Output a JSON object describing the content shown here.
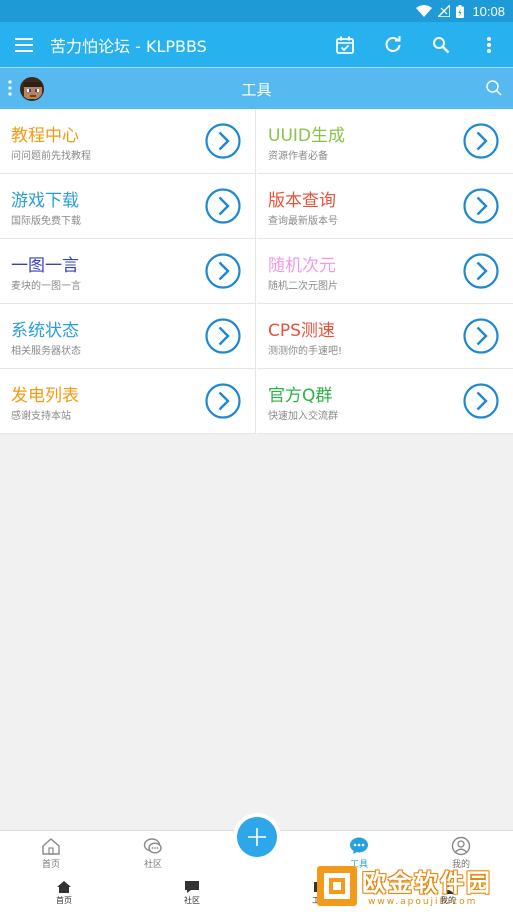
{
  "status_bar": {
    "time": "10:08"
  },
  "toolbar": {
    "title": "苦力怕论坛 - KLPBBS"
  },
  "subbar": {
    "title": "工具"
  },
  "tools": [
    {
      "title": "教程中心",
      "subtitle": "问问题前先找教程",
      "color": "#f39b12"
    },
    {
      "title": "UUID生成",
      "subtitle": "资源作者必备",
      "color": "#8bc34a"
    },
    {
      "title": "游戏下载",
      "subtitle": "国际版免费下载",
      "color": "#2b9fd8"
    },
    {
      "title": "版本查询",
      "subtitle": "查询最新版本号",
      "color": "#e5533d"
    },
    {
      "title": "一图一言",
      "subtitle": "麦块的一图一言",
      "color": "#3a3fbf"
    },
    {
      "title": "随机次元",
      "subtitle": "随机二次元图片",
      "color": "#f19be8"
    },
    {
      "title": "系统状态",
      "subtitle": "相关服务器状态",
      "color": "#2b9fd8"
    },
    {
      "title": "CPS测速",
      "subtitle": "测测你的手速吧!",
      "color": "#e5533d"
    },
    {
      "title": "发电列表",
      "subtitle": "感谢支持本站",
      "color": "#f39b12"
    },
    {
      "title": "官方Q群",
      "subtitle": "快速加入交流群",
      "color": "#2db344"
    }
  ],
  "bottom_nav": {
    "home": "首页",
    "community": "社区",
    "tools": "工具",
    "mine": "我的"
  },
  "bottom_nav2": {
    "home": "首页",
    "community": "社区",
    "tools": "工具",
    "mine": "我的"
  },
  "watermark": {
    "text": "欧金软件园",
    "url": "www.apoujin.com"
  },
  "colors": {
    "accent": "#27b1ee",
    "arrow": "#1e88d0",
    "active_tab": "#27a0e0"
  }
}
